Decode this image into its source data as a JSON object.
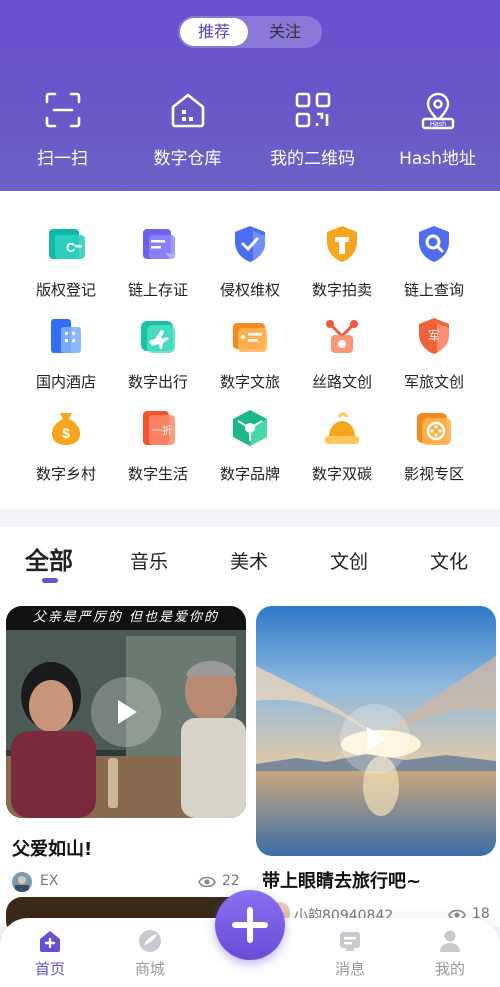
{
  "top_tabs": {
    "recommend": "推荐",
    "follow": "关注"
  },
  "quick_actions": [
    {
      "label": "扫一扫",
      "icon": "scan-icon"
    },
    {
      "label": "数字仓库",
      "icon": "warehouse-icon"
    },
    {
      "label": "我的二维码",
      "icon": "qrcode-icon"
    },
    {
      "label": "Hash地址",
      "icon": "hash-location-icon"
    }
  ],
  "services": [
    {
      "label": "版权登记",
      "icon": "copyright-register-icon"
    },
    {
      "label": "链上存证",
      "icon": "chain-evidence-icon"
    },
    {
      "label": "侵权维权",
      "icon": "shield-check-icon"
    },
    {
      "label": "数字拍卖",
      "icon": "auction-icon"
    },
    {
      "label": "链上查询",
      "icon": "search-icon"
    },
    {
      "label": "国内酒店",
      "icon": "hotel-icon"
    },
    {
      "label": "数字出行",
      "icon": "plane-icon"
    },
    {
      "label": "数字文旅",
      "icon": "ticket-icon"
    },
    {
      "label": "丝路文创",
      "icon": "network-icon"
    },
    {
      "label": "军旅文创",
      "icon": "army-shield-icon",
      "badge": "军"
    },
    {
      "label": "数字乡村",
      "icon": "money-bag-icon"
    },
    {
      "label": "数字生活",
      "icon": "discount-icon",
      "badge": "一折"
    },
    {
      "label": "数字品牌",
      "icon": "brand-cube-icon"
    },
    {
      "label": "数字双碳",
      "icon": "carbon-icon"
    },
    {
      "label": "影视专区",
      "icon": "film-icon"
    }
  ],
  "categories": [
    "全部",
    "音乐",
    "美术",
    "文创",
    "文化"
  ],
  "feed": [
    {
      "caption": "父亲是严厉的 但也是爱你的",
      "title": "父爱如山!",
      "author": "EX",
      "views": "22"
    },
    {
      "title": "带上眼睛去旅行吧~",
      "author": "小韵80940842",
      "views": "18"
    }
  ],
  "tabbar": [
    {
      "label": "首页",
      "icon": "home-icon",
      "active": true
    },
    {
      "label": "商城",
      "icon": "shop-icon"
    },
    {
      "label": "消息",
      "icon": "message-icon"
    },
    {
      "label": "我的",
      "icon": "profile-icon"
    }
  ],
  "colors": {
    "primary": "#6b4fd0",
    "header_bg": "#6a57c9",
    "tab_inactive": "#999999"
  }
}
